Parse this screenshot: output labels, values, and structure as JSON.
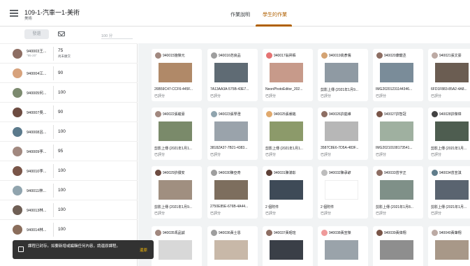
{
  "header": {
    "course_title": "109-1-汽車一1-美術",
    "course_subtitle": "美術",
    "tabs": [
      {
        "label": "作業說明"
      },
      {
        "label": "學生的作業"
      }
    ]
  },
  "toolbar": {
    "return_label": "發還",
    "points_placeholder": "100 分"
  },
  "students": [
    {
      "name": "940003王...",
      "grade": "75",
      "sub1": "\"95-20\"",
      "sub2": "尚未繳交",
      "color": "#8d6e63"
    },
    {
      "name": "940004江...",
      "grade": "90",
      "color": "#d7a27c"
    },
    {
      "name": "940005何...",
      "grade": "100",
      "color": "#7c8a6f"
    },
    {
      "name": "940007吳...",
      "grade": "90",
      "color": "#6d4c41"
    },
    {
      "name": "940008呂...",
      "grade": "100",
      "color": "#5b7a8c"
    },
    {
      "name": "940009李...",
      "grade": "95",
      "color": "#a1887f"
    },
    {
      "name": "940010李...",
      "grade": "100",
      "color": "#795548"
    },
    {
      "name": "940011林...",
      "grade": "100",
      "color": "#90a4ae"
    },
    {
      "name": "940013林...",
      "grade": "100",
      "color": "#6f5f55"
    },
    {
      "name": "940014林...",
      "grade": "100",
      "color": "#8a6d5b"
    }
  ],
  "submissions": [
    {
      "name": "940015施傑元",
      "file": "26B59C47-CCF6-445F...",
      "status": "已評分",
      "avatar": "#a1887f",
      "thumb": "#b08968"
    },
    {
      "name": "940016范良品",
      "file": "7A13AA3A-575B-43E7...",
      "status": "已評分",
      "avatar": "#9e9e9e",
      "thumb": "#5f6b74"
    },
    {
      "name": "940017翁昇栢",
      "file": "NeonPhotoEditor_202...",
      "status": "已評分",
      "avatar": "#e57373",
      "thumb": "#c79a8a"
    },
    {
      "name": "940019高彥儒",
      "file": "剪影上傳 (2021年1月9...",
      "status": "已評分",
      "avatar": "#d4a373",
      "thumb": "#8f9aa3"
    },
    {
      "name": "940020康鍵丞",
      "file": "IMG20201231144346...",
      "status": "已評分",
      "avatar": "#8d6e63",
      "thumb": "#7a8c99"
    },
    {
      "name": "940021張文豪",
      "file": "6FD1F883-85A2-4A8...",
      "status": "已評分",
      "avatar": "#bcaaa4",
      "thumb": "#6b5d52"
    },
    {
      "name": "940022張峻豪",
      "file": "剪影上傳 (2021年1月1...",
      "status": "已評分",
      "avatar": "#a1887f",
      "thumb": "#7a8a6a"
    },
    {
      "name": "940023張學澄",
      "file": "3818ZA37-7B21-4383...",
      "status": "已評分",
      "avatar": "#90a4ae",
      "thumb": "#9aa3ab"
    },
    {
      "name": "940025張睿銘",
      "file": "剪影上傳 (2021年1月1...",
      "status": "已評分",
      "avatar": "#e0a96d",
      "thumb": "#8c9a6a"
    },
    {
      "name": "940026許庭維",
      "file": "3587C8E6-7D5A-483F...",
      "status": "已評分",
      "avatar": "#8d6e63",
      "thumb": "#b7b7b7"
    },
    {
      "name": "940027許智冠",
      "file": "IMG20210108173541...",
      "status": "已評分",
      "avatar": "#795548",
      "thumb": "#9fb0a0"
    },
    {
      "name": "940028許傑瑋",
      "file": "剪影上傳 (2021年1月...",
      "status": "已評分",
      "avatar": "#424242",
      "thumb": "#4e5d50"
    },
    {
      "name": "940029許價安",
      "file": "剪影上傳 (2021年1月9...",
      "status": "已評分",
      "avatar": "#6d4c41",
      "thumb": "#a08f80"
    },
    {
      "name": "940030陳亞奇",
      "file": "2750E85E-676B-4A44...",
      "status": "已評分",
      "avatar": "#9e9e9e",
      "thumb": "#7d6e5e"
    },
    {
      "name": "940031陳滿彰",
      "file": "2 個附件",
      "status": "已評分",
      "avatar": "#5d4037",
      "thumb": "#3e4a57"
    },
    {
      "name": "940032陳承諺",
      "file": "2 個附件",
      "status": "已評分",
      "avatar": "#bdbdbd",
      "thumb": "#ffffff"
    },
    {
      "name": "940033曾宇正",
      "file": "剪影上傳 (2021年1月8...",
      "status": "已評分",
      "avatar": "#8d6e63",
      "thumb": "#7f9088"
    },
    {
      "name": "940034曾宣淇",
      "file": "剪影上傳 (2021年1月...",
      "status": "已評分",
      "avatar": "#607d8b",
      "thumb": "#5a6470"
    },
    {
      "name": "940035馮品誠",
      "file": "",
      "status": "",
      "avatar": "#a1887f",
      "thumb": "#d8d8d8"
    },
    {
      "name": "940036黃士恩",
      "file": "",
      "status": "",
      "avatar": "#9e9e9e",
      "thumb": "#c8b8a8"
    },
    {
      "name": "940037黃昭瑄",
      "file": "",
      "status": "",
      "avatar": "#8d6e63",
      "thumb": "#3a3f47"
    },
    {
      "name": "940038黃宣傑",
      "file": "",
      "status": "",
      "avatar": "#ef9a9a",
      "thumb": "#9aa3aa"
    },
    {
      "name": "940039黃偉翔",
      "file": "",
      "status": "",
      "avatar": "#795548",
      "thumb": "#8e8e8e"
    },
    {
      "name": "940040黃肇翔",
      "file": "",
      "status": "",
      "avatar": "#bcaaa4",
      "thumb": "#a89888"
    }
  ],
  "snackbar": {
    "message": "課程已封存。如要新增或編輯任何內容，請還原課程。",
    "action": "還原"
  }
}
